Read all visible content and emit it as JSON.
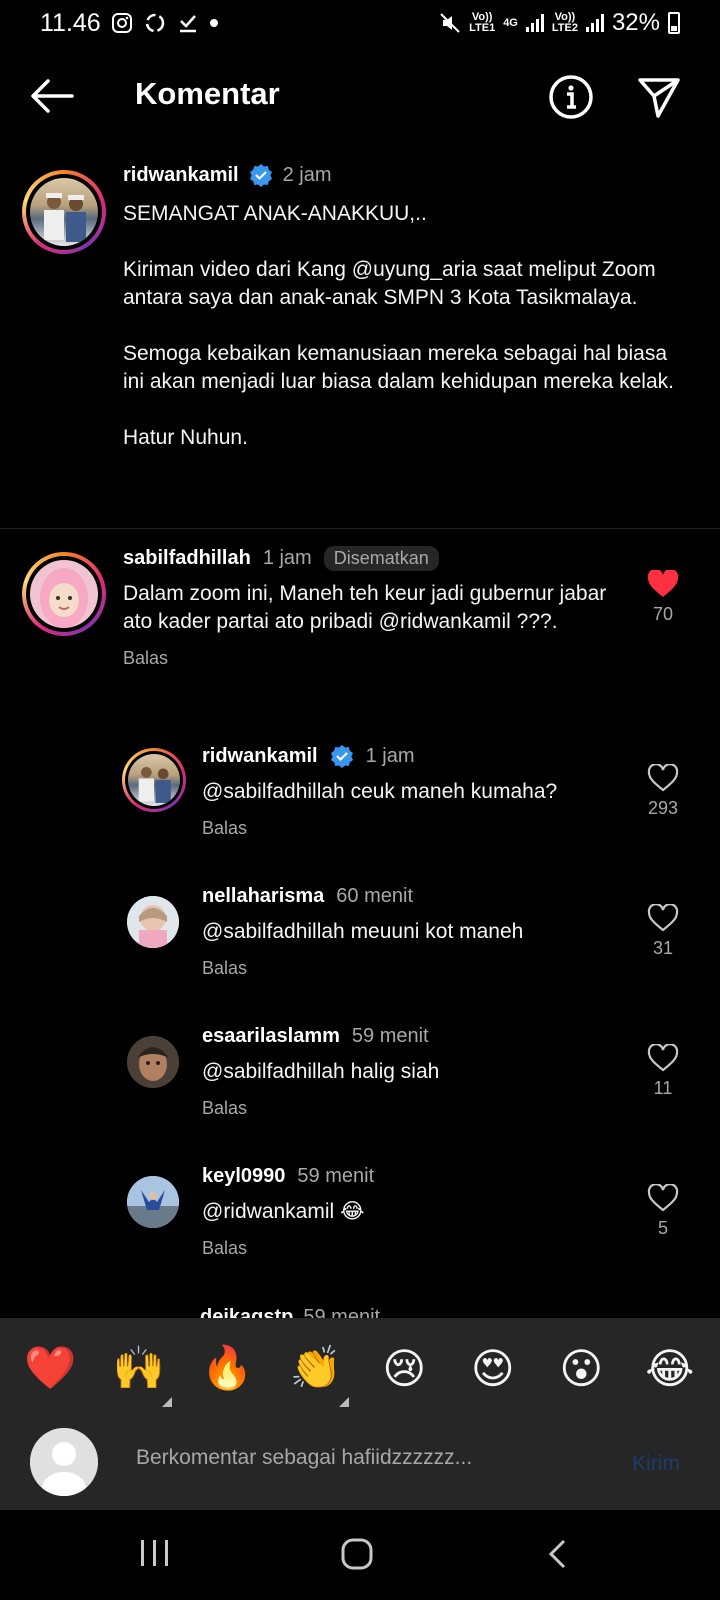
{
  "status_bar": {
    "time": "11.46",
    "net1": "Vo))",
    "net1_sub": "LTE1",
    "net_type": "4G",
    "net2": "Vo))",
    "net2_sub": "LTE2",
    "battery": "32%"
  },
  "header": {
    "title": "Komentar",
    "back_icon": "arrow-left-icon",
    "info_icon": "info-icon",
    "share_icon": "send-icon"
  },
  "caption": {
    "username": "ridwankamil",
    "time": "2 jam",
    "text": "SEMANGAT ANAK-ANAKKUU,..\n\nKiriman video dari Kang @uyung_aria saat meliput Zoom antara saya dan anak-anak SMPN 3 Kota Tasikmalaya.\n\nSemoga kebaikan kemanusiaan mereka sebagai hal biasa ini akan menjadi luar biasa dalam kehidupan mereka kelak.\n\nHatur Nuhun."
  },
  "comments": [
    {
      "username": "sabilfadhillah",
      "time": "1 jam",
      "badge": "Disematkan",
      "text": "Dalam zoom ini, Maneh teh keur jadi gubernur jabar ato kader partai ato pribadi @ridwankamil ???.",
      "reply": "Balas",
      "likes": "70",
      "liked": true
    }
  ],
  "replies": [
    {
      "username": "ridwankamil",
      "verified": true,
      "time": "1 jam",
      "text": "@sabilfadhillah ceuk maneh kumaha?",
      "reply": "Balas",
      "likes": "293"
    },
    {
      "username": "nellaharisma",
      "time": "60 menit",
      "text": "@sabilfadhillah meuuni kot maneh",
      "reply": "Balas",
      "likes": "31"
    },
    {
      "username": "esaarilaslamm",
      "time": "59 menit",
      "text": "@sabilfadhillah halig siah",
      "reply": "Balas",
      "likes": "11"
    },
    {
      "username": "keyl0990",
      "time": "59 menit",
      "text": "@ridwankamil 😂",
      "reply": "Balas",
      "likes": "5"
    }
  ],
  "peek": {
    "username": "deikagstp",
    "time": "59 menit"
  },
  "emoji_bar": [
    "❤️",
    "🙌",
    "🔥",
    "👏",
    "😢",
    "😍",
    "😮",
    "😂"
  ],
  "composer": {
    "placeholder": "Berkomentar sebagai hafiidzzzzzz...",
    "send_label": "Kirim"
  },
  "colors": {
    "background": "#000000",
    "liked_heart": "#ff3040",
    "verified": "#3897f0",
    "secondary_text": "#a8a8a8"
  }
}
